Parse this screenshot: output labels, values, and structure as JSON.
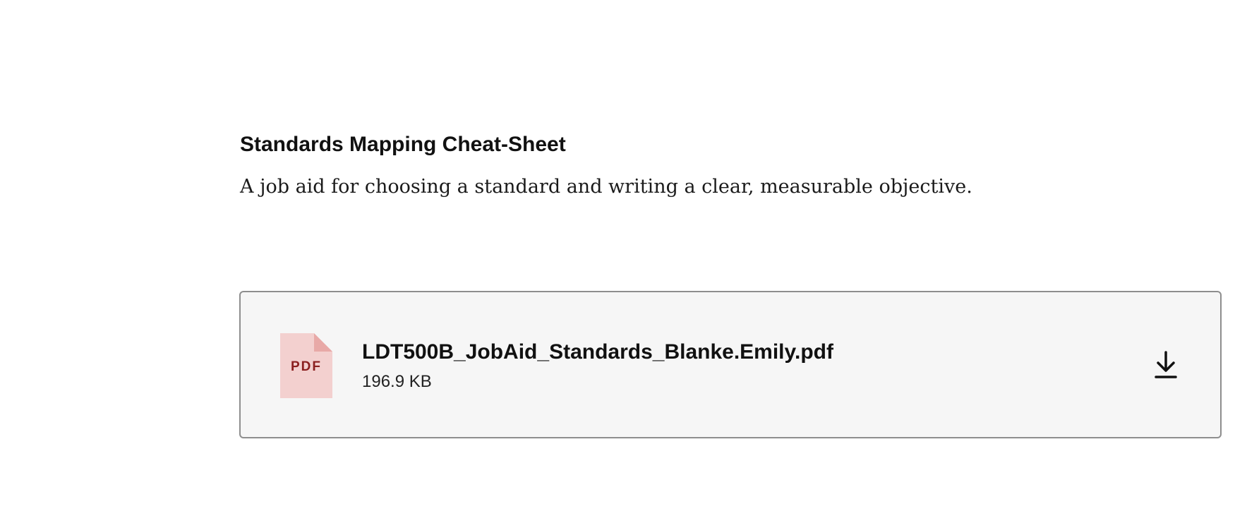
{
  "header": {
    "title": "Standards Mapping Cheat-Sheet",
    "description": "A job aid for choosing a standard and writing a clear, measurable objective."
  },
  "attachment": {
    "file_type_label": "PDF",
    "file_name": "LDT500B_JobAid_Standards_Blanke.Emily.pdf",
    "file_size": "196.9 KB",
    "icon": "pdf-file-icon",
    "action_icon": "download-icon"
  },
  "colors": {
    "card_background": "#f6f6f6",
    "card_border": "#8e8e8e",
    "pdf_icon_fill": "#f3d0cf",
    "pdf_icon_fold": "#e8a9a7",
    "pdf_label": "#8b2020"
  }
}
